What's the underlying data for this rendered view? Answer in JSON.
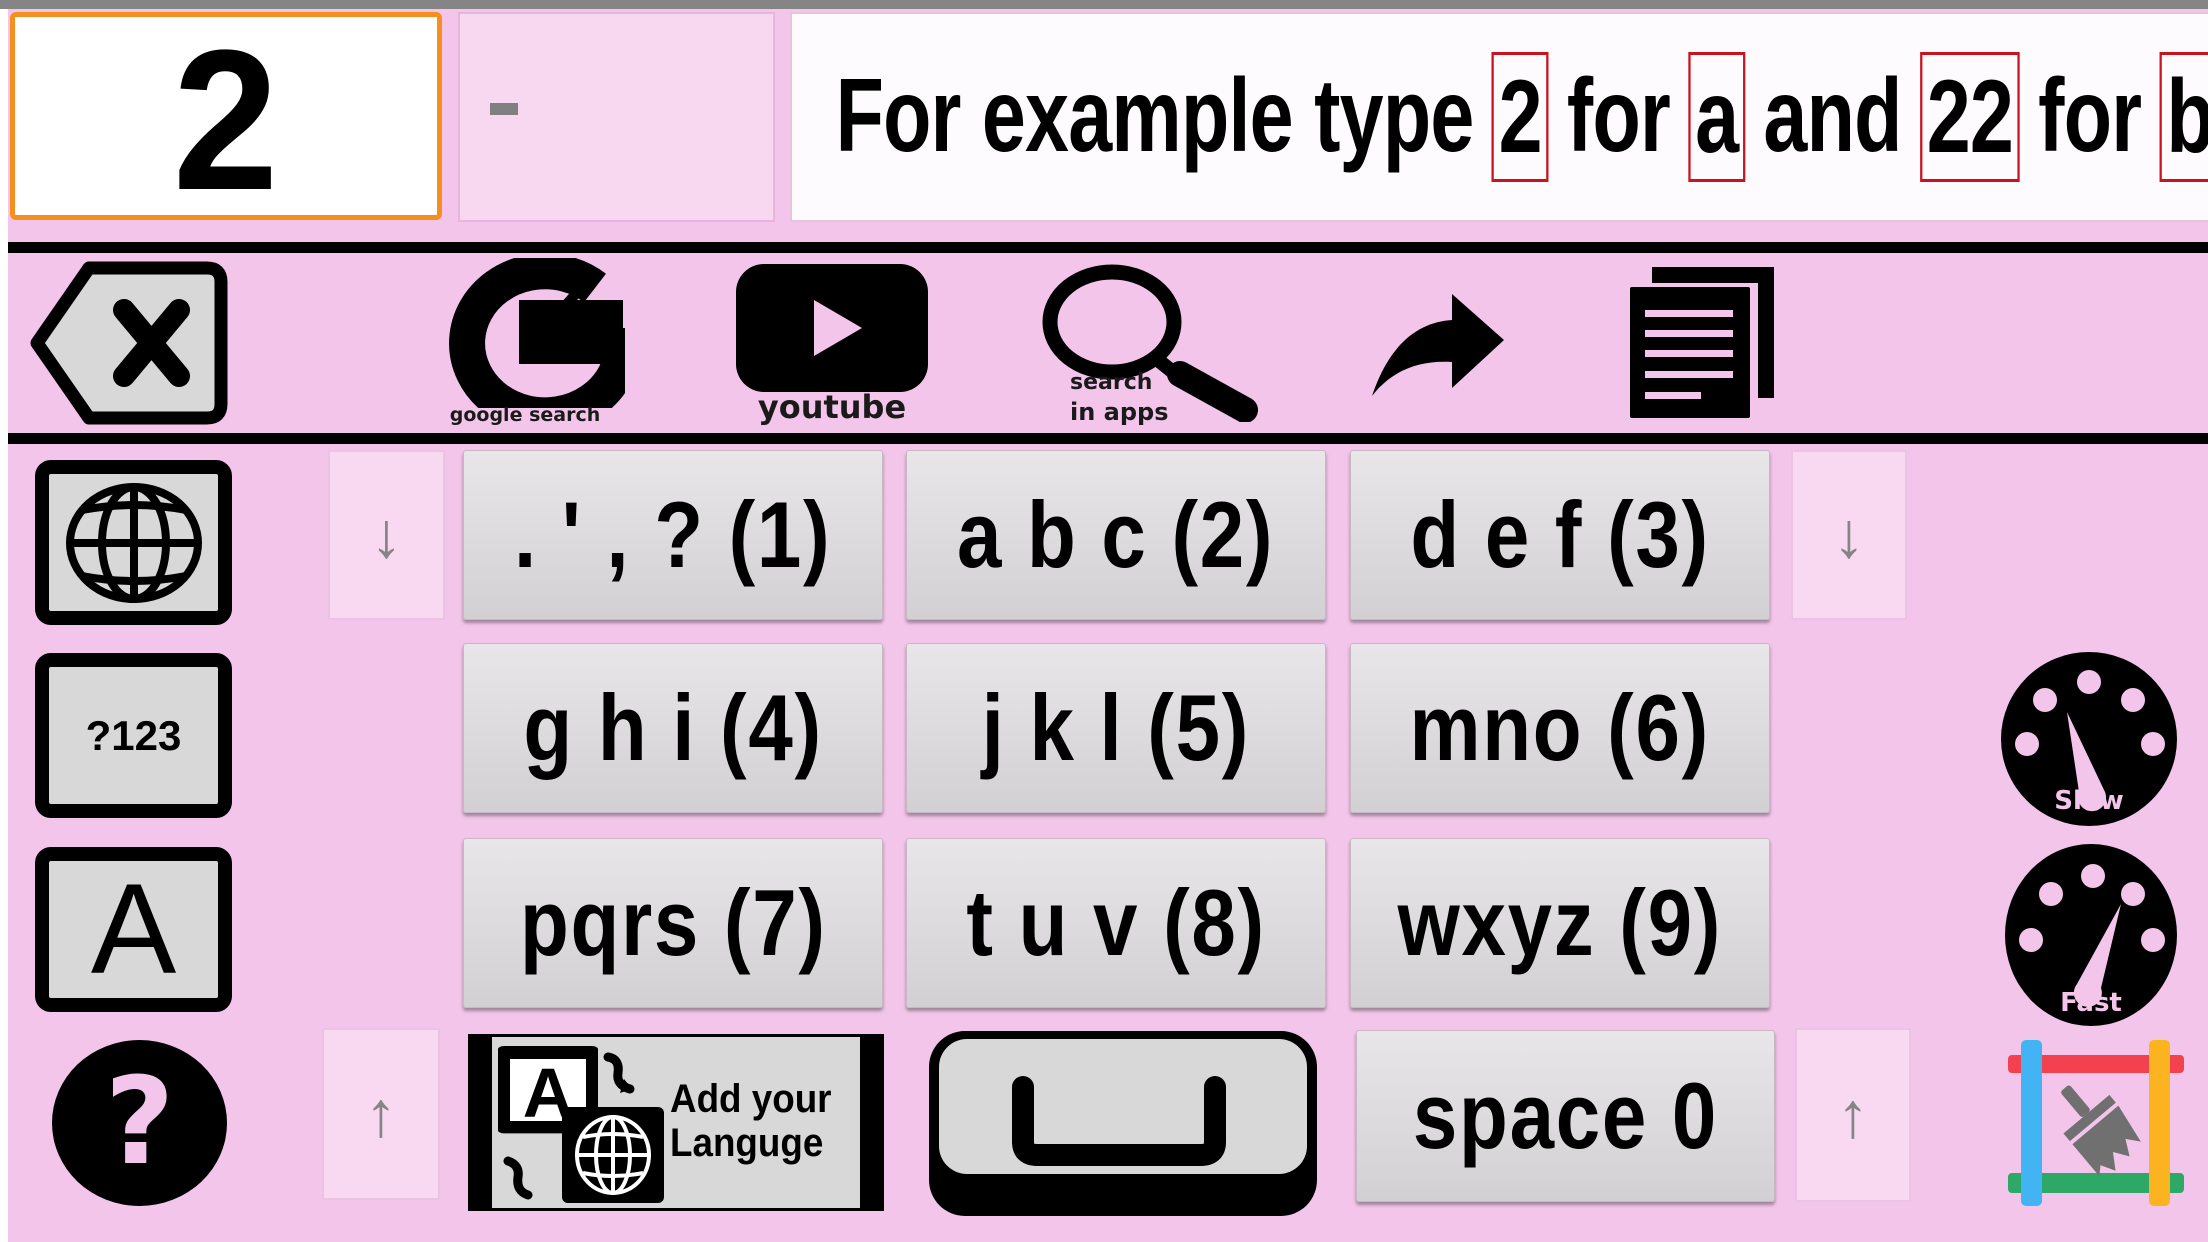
{
  "display": {
    "current_digits": "2",
    "pending_text": "-",
    "hint": {
      "segments": [
        {
          "text": "For example type",
          "highlight": false
        },
        {
          "text": "2",
          "highlight": true
        },
        {
          "text": "for",
          "highlight": false
        },
        {
          "text": "a",
          "highlight": true
        },
        {
          "text": "and",
          "highlight": false
        },
        {
          "text": "22",
          "highlight": true
        },
        {
          "text": "for",
          "highlight": false
        },
        {
          "text": "b",
          "highlight": true
        }
      ]
    }
  },
  "toolbar": {
    "backspace": {
      "icon": "backspace-icon"
    },
    "google": {
      "icon": "google-g-icon",
      "label": "google search"
    },
    "youtube": {
      "icon": "youtube-play-icon",
      "label": "youtube"
    },
    "search_apps": {
      "icon": "magnifier-icon",
      "label_line1": "search",
      "label_line2": "in apps"
    },
    "share": {
      "icon": "share-arrow-icon"
    },
    "copy": {
      "icon": "copy-document-icon"
    }
  },
  "side_left": {
    "language": {
      "icon": "globe-icon"
    },
    "symbols": {
      "label": "?123"
    },
    "case": {
      "label": "A"
    },
    "help": {
      "icon": "question-icon",
      "label": "?"
    }
  },
  "keypad": {
    "rows": [
      [
        "., ' , ? (1)",
        "a b c (2)",
        "d e f (3)"
      ],
      [
        "g h i (4)",
        "j k l (5)",
        "mno (6)"
      ],
      [
        "pqrs (7)",
        "t u v (8)",
        "wxyz (9)"
      ]
    ],
    "row1": [
      ". ' , ? (1)",
      "a b c (2)",
      "d e f (3)"
    ],
    "row2": [
      "g h i (4)",
      "j k l (5)",
      "mno (6)"
    ],
    "row3": [
      "pqrs (7)",
      "t u v (8)",
      "wxyz (9)"
    ],
    "bottom": {
      "add_language_line1": "Add your",
      "add_language_line2": "Languge",
      "space_label": "space 0"
    },
    "arrows": {
      "down": "↓",
      "up": "↑"
    }
  },
  "side_right": {
    "speed_slow_label": "Slow",
    "speed_fast_label": "Fast",
    "clear": {
      "icon": "clear-brush-icon"
    }
  },
  "colors": {
    "background": "#f3c5ea",
    "accent_orange": "#f5901e",
    "highlight_red": "#c8141e",
    "key_gray": "#dcdadc",
    "clear_red": "#f44150",
    "clear_blue": "#42b4f4",
    "clear_orange": "#fbb41f",
    "clear_green": "#2ea866"
  }
}
